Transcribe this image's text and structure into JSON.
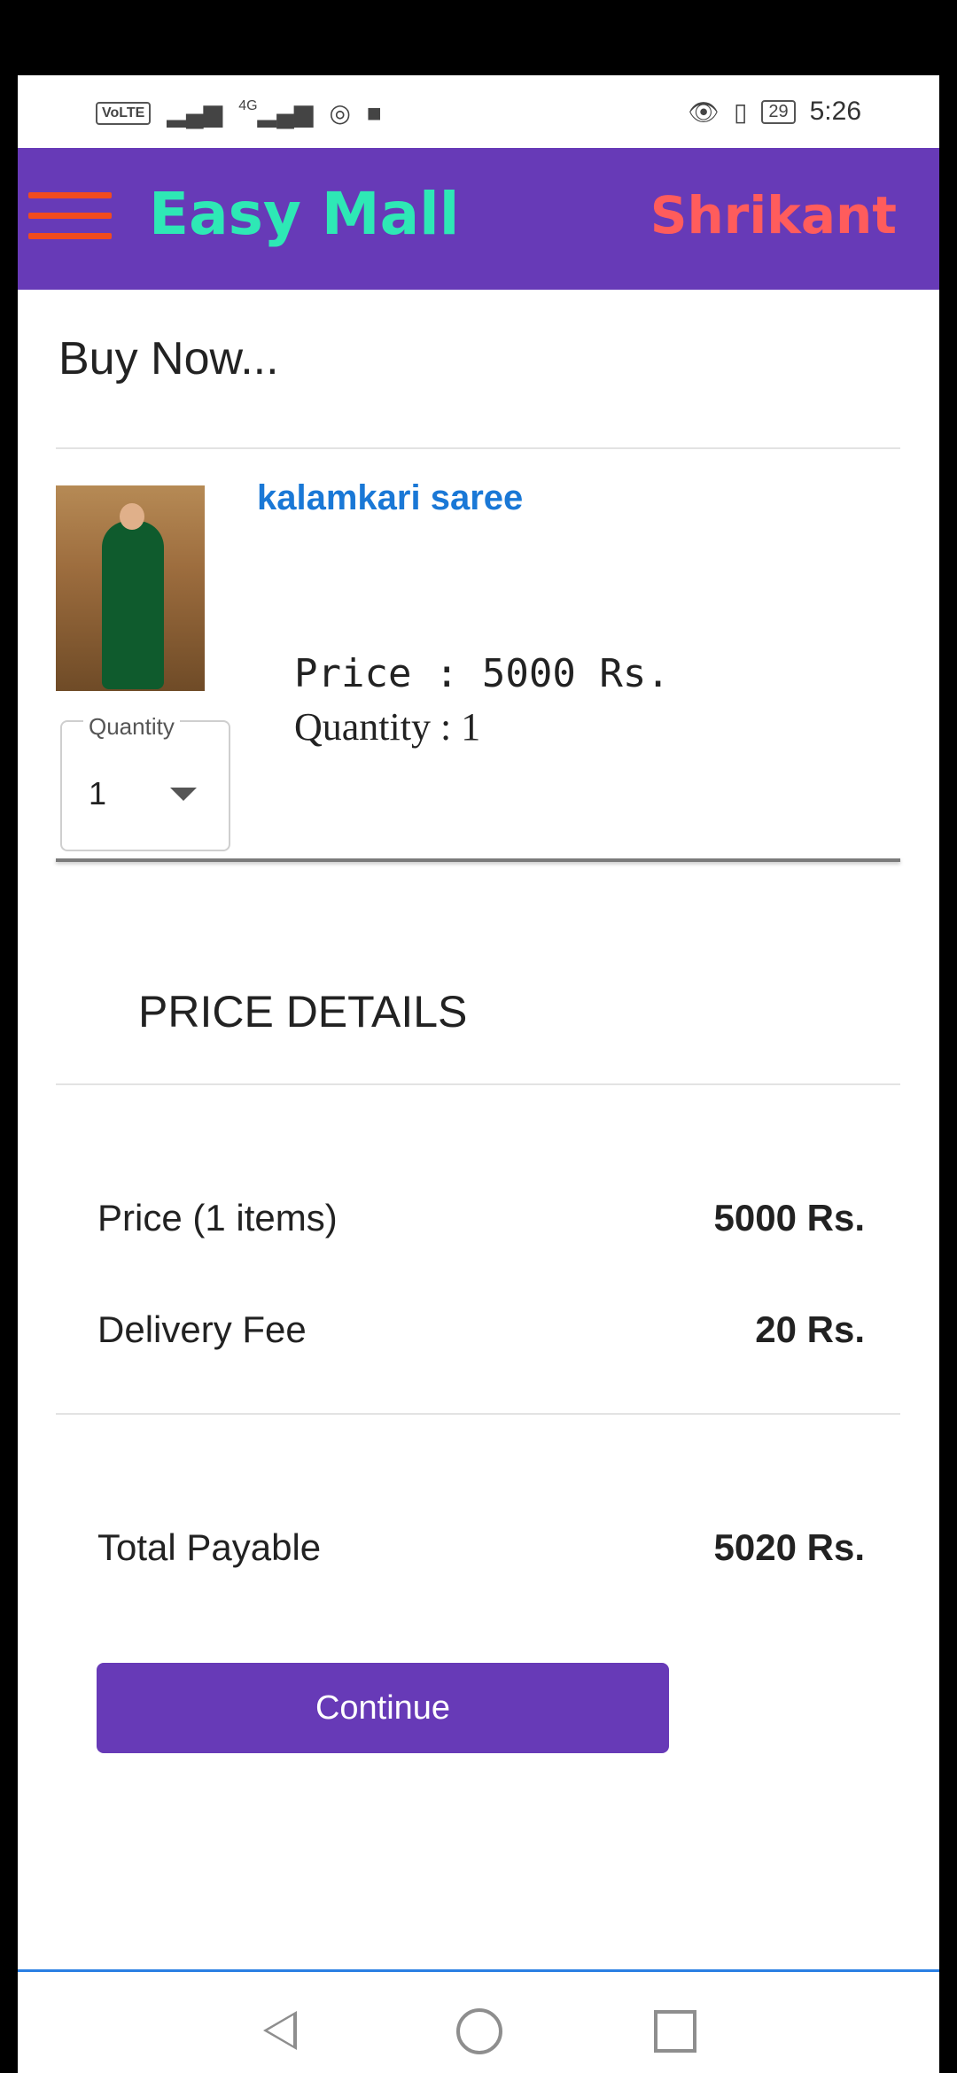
{
  "status_bar": {
    "left_icons": [
      "volte-icon",
      "signal-icon",
      "4g-signal-icon",
      "hotspot-icon",
      "stop-icon"
    ],
    "volte": "VoLTE",
    "network": "4G",
    "battery": "29",
    "time": "5:26"
  },
  "app_bar": {
    "title": "Easy Mall",
    "user_name": "Shrikant",
    "colors": {
      "bar": "#673ab7",
      "title": "#2ee8b5",
      "user": "#ff5c5c",
      "menu": "#f24b1e"
    }
  },
  "page": {
    "heading": "Buy Now..."
  },
  "product": {
    "name": "kalamkari saree",
    "price_text": "Price : 5000 Rs.",
    "quantity_text": "Quantity : 1",
    "quantity_selector": {
      "label": "Quantity",
      "value": "1"
    }
  },
  "price_details": {
    "title": "PRICE DETAILS",
    "rows": [
      {
        "label": "Price (1 items)",
        "value": "5000 Rs."
      },
      {
        "label": "Delivery Fee",
        "value": "20 Rs."
      }
    ],
    "total": {
      "label": "Total Payable",
      "value": "5020 Rs."
    }
  },
  "actions": {
    "continue_label": "Continue"
  },
  "nav_bar": {
    "buttons": [
      "back-icon",
      "home-icon",
      "recents-icon"
    ]
  }
}
